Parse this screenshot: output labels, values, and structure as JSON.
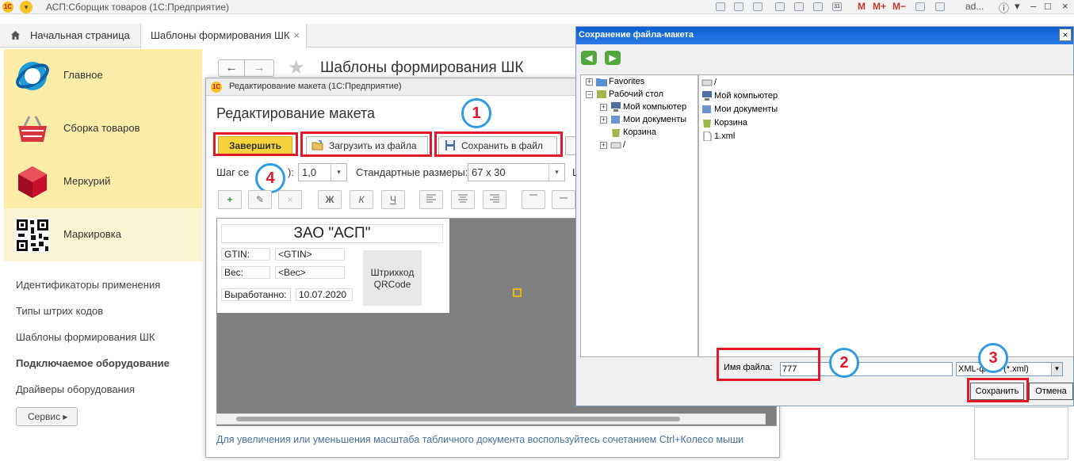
{
  "topbar": {
    "app_title": "АСП:Сборщик товаров  (1С:Предприятие)",
    "logo": "1С",
    "menu_icon": "▾",
    "tools": [
      "M",
      "M+",
      "M−"
    ],
    "user": "ad...",
    "calendar_day": "31"
  },
  "tabs": {
    "home": "Начальная страница",
    "templates": "Шаблоны формирования ШК",
    "close": "×"
  },
  "sidebar": {
    "sections": [
      {
        "label": "Главное",
        "icon": "main-globe-icon"
      },
      {
        "label": "Сборка товаров",
        "icon": "shopping-basket-icon"
      },
      {
        "label": "Меркурий",
        "icon": "red-cube-icon"
      },
      {
        "label": "Маркировка",
        "icon": "qr-code-icon",
        "active": true
      }
    ],
    "items": [
      {
        "label": "Идентификаторы применения"
      },
      {
        "label": "Типы штрих кодов"
      },
      {
        "label": "Шаблоны формирования ШК"
      },
      {
        "label": "Подключаемое оборудование",
        "bold": true
      },
      {
        "label": "Драйверы оборудования"
      }
    ],
    "service": "Сервис ▸"
  },
  "bg_form": {
    "title": "Шаблоны формирования ШК",
    "back": "←",
    "forward": "→",
    "star": "★"
  },
  "edit_window": {
    "window_title": "Редактирование макета  (1С:Предприятие)",
    "heading": "Редактирование макета",
    "buttons": {
      "finish": "Завершить",
      "load": "Загрузить из файла",
      "save": "Сохранить в файл"
    },
    "grid_label_start": "Шаг се",
    "grid_label_end": "):",
    "grid_value": "1,0",
    "sizes_label": "Стандартные размеры:",
    "sizes_value": "67 x 30",
    "sh_label": "Ш",
    "format_buttons": [
      "+",
      "✎",
      "×",
      "Ж",
      "К",
      "Ч"
    ],
    "template": {
      "company": "ЗАО \"АСП\"",
      "gtin_label": "GTIN:",
      "gtin_value": "<GTIN>",
      "weight_label": "Вес:",
      "weight_value": "<Вес>",
      "made_label": "Выработанно:",
      "made_value": "10.07.2020",
      "qr_line1": "Штрихкод",
      "qr_line2": "QRCode"
    },
    "hint": "Для увеличения или уменьшения масштаба табличного документа воспользуйтесь сочетанием Ctrl+Колесо мыши"
  },
  "save_dialog": {
    "title": "Сохранение файла-макета",
    "close": "×",
    "tree": [
      {
        "label": "Favorites",
        "expander": "+"
      },
      {
        "label": "Рабочий стол",
        "expander": "−"
      },
      {
        "label": "Мой компьютер",
        "expander": "+"
      },
      {
        "label": "Мои документы",
        "expander": "+"
      },
      {
        "label": "Корзина",
        "expander": ""
      },
      {
        "label": "/",
        "expander": "+"
      }
    ],
    "files": [
      {
        "label": "/"
      },
      {
        "label": "Мой компьютер"
      },
      {
        "label": "Мои документы"
      },
      {
        "label": "Корзина"
      },
      {
        "label": "1.xml"
      }
    ],
    "filename_label": "Имя файла:",
    "filename_value": "777",
    "filetype_value": "XML-файл (*.xml)",
    "save_button": "Сохранить",
    "cancel_button": "Отмена"
  },
  "annotations": {
    "badge_1": "1",
    "badge_2": "2",
    "badge_3": "3",
    "badge_4": "4"
  },
  "colors": {
    "sidebar_bg": "#fbeca8",
    "accent_yellow": "#f5d33c",
    "highlight_red": "#e0192c",
    "badge_blue": "#2e9be3",
    "dialog_title_blue": "#0a5fd0",
    "hint_blue": "#4a6fa0"
  }
}
